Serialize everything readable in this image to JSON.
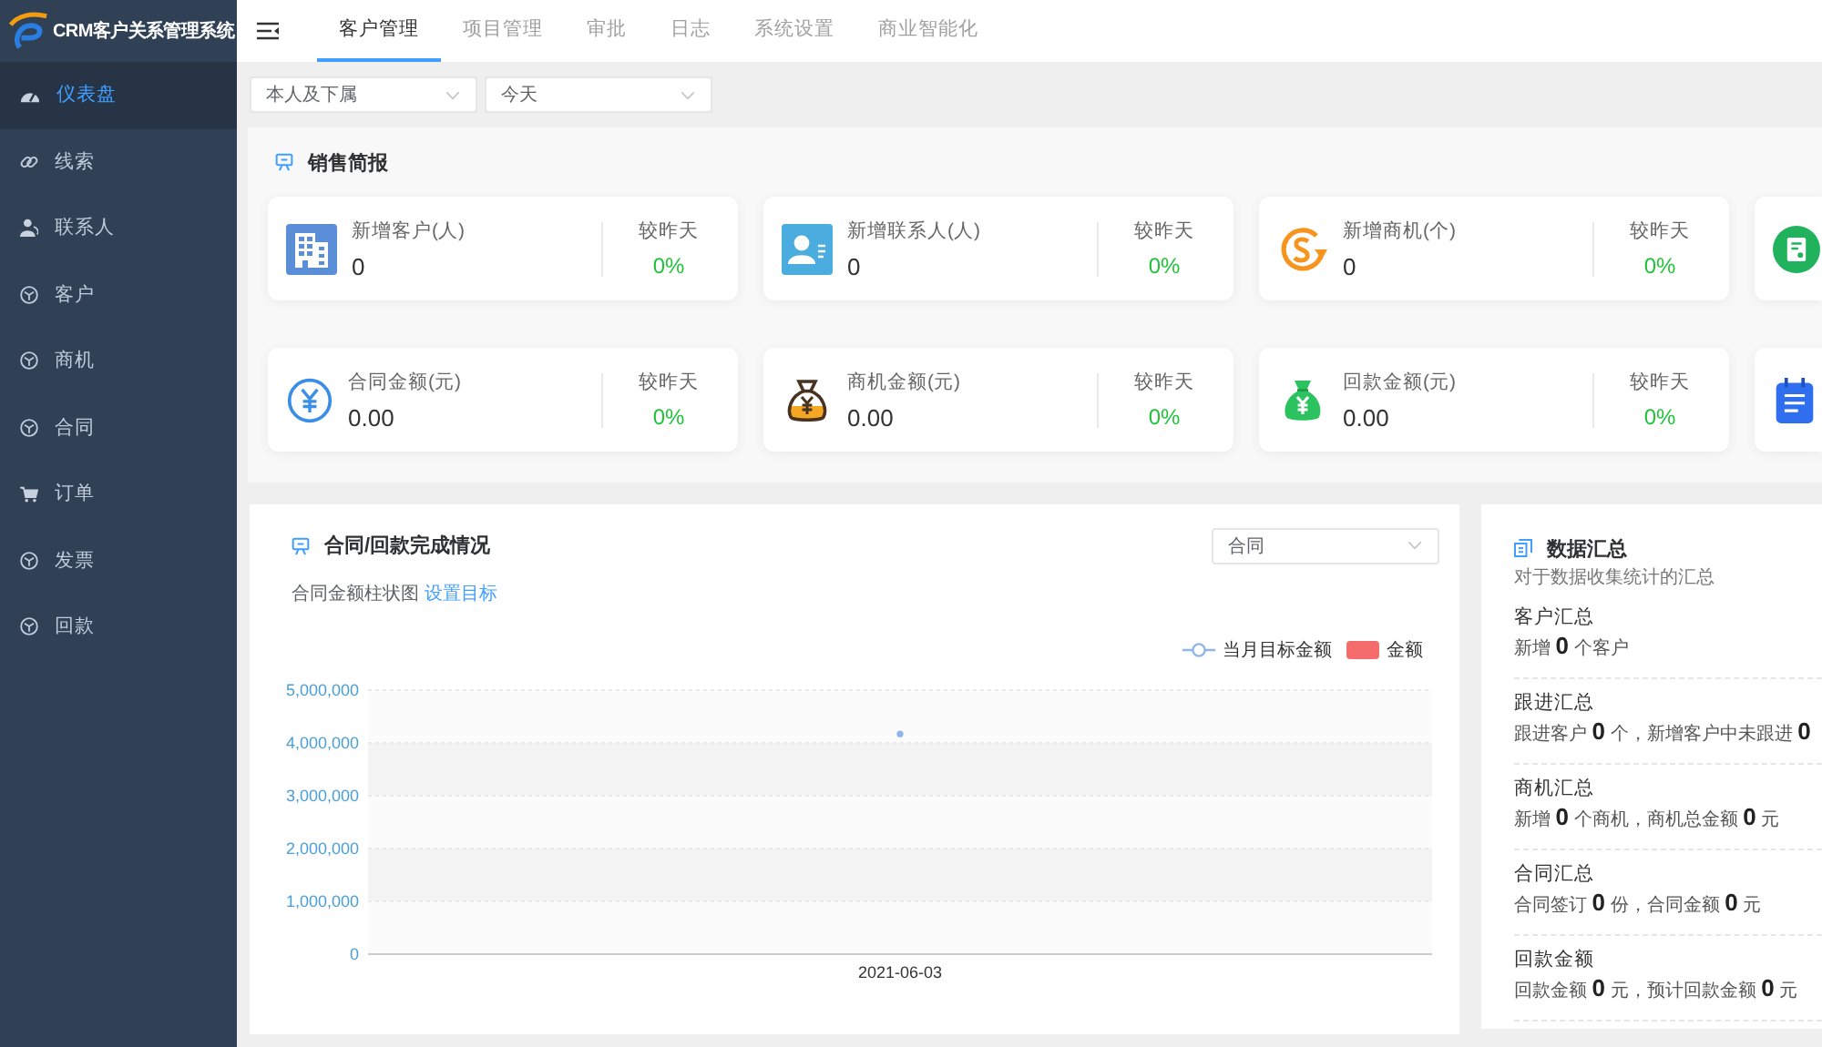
{
  "sidebar": {
    "logo_text": "CRM客户关系管理系统",
    "items": [
      {
        "label": "仪表盘",
        "selected": true
      },
      {
        "label": "线索",
        "selected": false
      },
      {
        "label": "联系人",
        "selected": false
      },
      {
        "label": "客户",
        "selected": false
      },
      {
        "label": "商机",
        "selected": false
      },
      {
        "label": "合同",
        "selected": false
      },
      {
        "label": "订单",
        "selected": false
      },
      {
        "label": "发票",
        "selected": false
      },
      {
        "label": "回款",
        "selected": false
      }
    ]
  },
  "top_nav": {
    "tabs": [
      {
        "label": "客户管理",
        "selected": true
      },
      {
        "label": "项目管理",
        "selected": false
      },
      {
        "label": "审批",
        "selected": false
      },
      {
        "label": "日志",
        "selected": false
      },
      {
        "label": "系统设置",
        "selected": false
      },
      {
        "label": "商业智能化",
        "selected": false
      }
    ]
  },
  "filters": [
    {
      "value": "本人及下属"
    },
    {
      "value": "今天"
    }
  ],
  "sales_brief": {
    "title": "销售简报",
    "cards": [
      {
        "kind": "full",
        "label": "新增客户(人)",
        "value": "0",
        "compare_label": "较昨天",
        "change": "0%"
      },
      {
        "kind": "full",
        "label": "新增联系人(人)",
        "value": "0",
        "compare_label": "较昨天",
        "change": "0%"
      },
      {
        "kind": "full",
        "label": "新增商机(个)",
        "value": "0",
        "compare_label": "较昨天",
        "change": "0%"
      },
      {
        "kind": "clipped"
      },
      {
        "kind": "full",
        "label": "合同金额(元)",
        "value": "0.00",
        "compare_label": "较昨天",
        "change": "0%"
      },
      {
        "kind": "full",
        "label": "商机金额(元)",
        "value": "0.00",
        "compare_label": "较昨天",
        "change": "0%"
      },
      {
        "kind": "full",
        "label": "回款金额(元)",
        "value": "0.00",
        "compare_label": "较昨天",
        "change": "0%"
      },
      {
        "kind": "clipped"
      }
    ]
  },
  "chart_panel": {
    "title": "合同/回款完成情况",
    "select": {
      "value": "合同"
    },
    "subtitle": "合同金额柱状图",
    "link": "设置目标",
    "chart_data": {
      "type": "line",
      "categories": [
        "2021-06-03"
      ],
      "series": [
        {
          "name": "当月目标金额",
          "color": "#8fb4ee",
          "values": [
            4170000
          ],
          "marker": true
        },
        {
          "name": "金额",
          "color": "#f56c6c",
          "values": [
            null
          ]
        }
      ],
      "ylim": [
        0,
        5000000
      ],
      "yticks": [
        {
          "value": 0,
          "label": "0"
        },
        {
          "value": 1000000,
          "label": "1,000,000"
        },
        {
          "value": 2000000,
          "label": "2,000,000"
        },
        {
          "value": 3000000,
          "label": "3,000,000"
        },
        {
          "value": 4000000,
          "label": "4,000,000"
        },
        {
          "value": 5000000,
          "label": "5,000,000"
        }
      ],
      "grid": true
    }
  },
  "data_summary": {
    "title": "数据汇总",
    "subtitle": "对于数据收集统计的汇总",
    "sections": [
      {
        "heading": "客户汇总",
        "text": "新增 **0** 个客户"
      },
      {
        "heading": "跟进汇总",
        "text": "跟进客户 **0** 个，新增客户中未跟进 **0**"
      },
      {
        "heading": "商机汇总",
        "text": "新增 **0** 个商机，商机总金额 **0** 元"
      },
      {
        "heading": "合同汇总",
        "text": "合同签订 **0** 份，合同金额 **0** 元"
      },
      {
        "heading": "回款金额",
        "text": "回款金额 **0** 元，预计回款金额 **0** 元"
      }
    ]
  }
}
